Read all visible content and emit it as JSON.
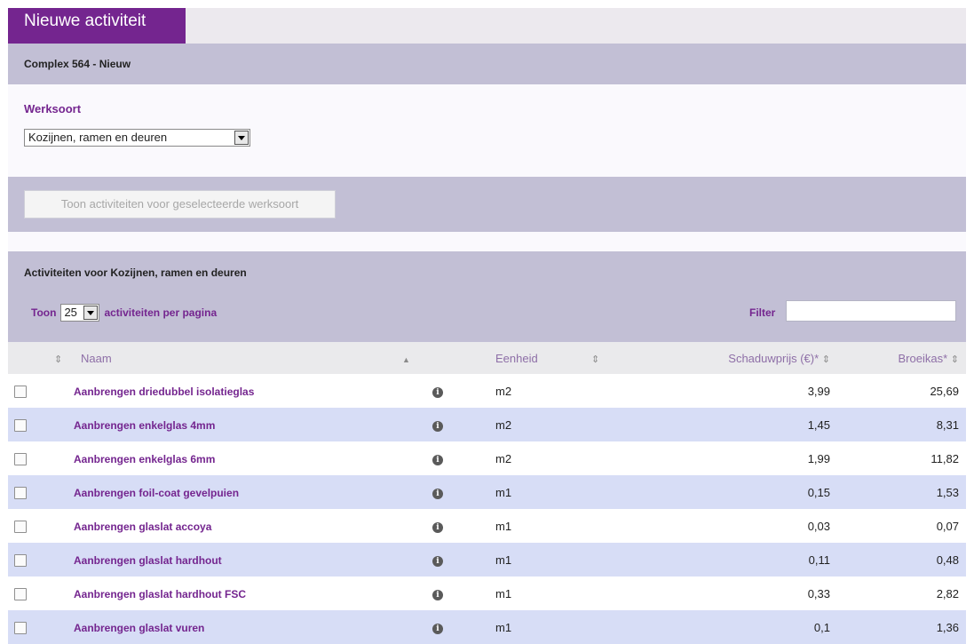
{
  "tab": {
    "title": "Nieuwe activiteit"
  },
  "subtitle": "Complex 564 - Nieuw",
  "werksoort": {
    "label": "Werksoort",
    "selected": "Kozijnen, ramen en deuren"
  },
  "show_button": "Toon activiteiten voor geselecteerde werksoort",
  "list": {
    "title": "Activiteiten voor Kozijnen, ramen en deuren",
    "toon_label": "Toon",
    "per_page": "25",
    "per_page_suffix": "activiteiten per pagina",
    "filter_label": "Filter",
    "filter_value": ""
  },
  "columns": {
    "naam": "Naam",
    "eenheid": "Eenheid",
    "schaduwprijs": "Schaduwprijs (€)*",
    "broeikas": "Broeikas*"
  },
  "rows": [
    {
      "naam": "Aanbrengen driedubbel isolatieglas",
      "eenheid": "m2",
      "schaduwprijs": "3,99",
      "broeikas": "25,69"
    },
    {
      "naam": "Aanbrengen enkelglas 4mm",
      "eenheid": "m2",
      "schaduwprijs": "1,45",
      "broeikas": "8,31"
    },
    {
      "naam": "Aanbrengen enkelglas 6mm",
      "eenheid": "m2",
      "schaduwprijs": "1,99",
      "broeikas": "11,82"
    },
    {
      "naam": "Aanbrengen foil-coat gevelpuien",
      "eenheid": "m1",
      "schaduwprijs": "0,15",
      "broeikas": "1,53"
    },
    {
      "naam": "Aanbrengen glaslat accoya",
      "eenheid": "m1",
      "schaduwprijs": "0,03",
      "broeikas": "0,07"
    },
    {
      "naam": "Aanbrengen glaslat hardhout",
      "eenheid": "m1",
      "schaduwprijs": "0,11",
      "broeikas": "0,48"
    },
    {
      "naam": "Aanbrengen glaslat hardhout FSC",
      "eenheid": "m1",
      "schaduwprijs": "0,33",
      "broeikas": "2,82"
    },
    {
      "naam": "Aanbrengen glaslat vuren",
      "eenheid": "m1",
      "schaduwprijs": "0,1",
      "broeikas": "1,36"
    }
  ],
  "colors": {
    "accent": "#74258f",
    "band": "#c2bfd5",
    "row_alt": "#d7ddf6"
  }
}
